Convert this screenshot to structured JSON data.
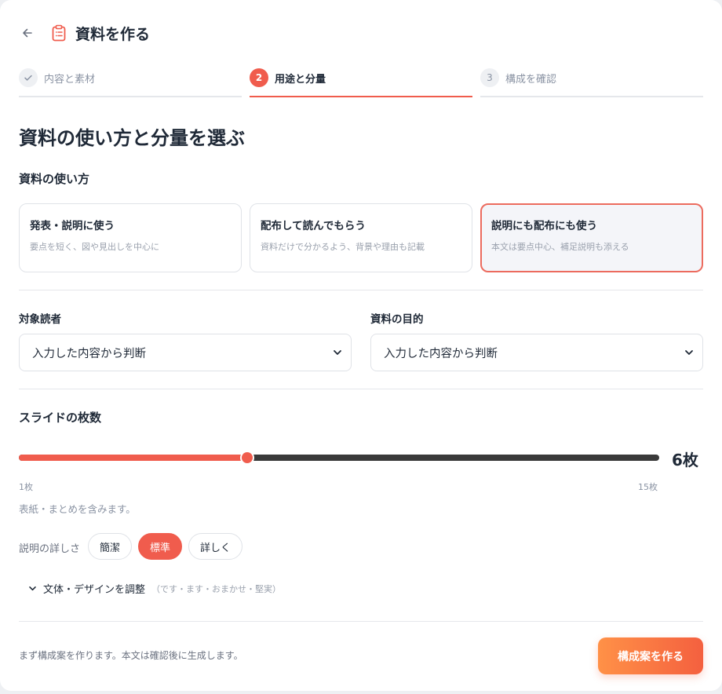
{
  "header": {
    "title": "資料を作る"
  },
  "steps": [
    {
      "number": "✓",
      "label": "内容と素材",
      "state": "done"
    },
    {
      "number": "2",
      "label": "用途と分量",
      "state": "current"
    },
    {
      "number": "3",
      "label": "構成を確認",
      "state": "todo"
    }
  ],
  "page_heading": "資料の使い方と分量を選ぶ",
  "usage": {
    "label": "資料の使い方",
    "options": [
      {
        "title": "発表・説明に使う",
        "desc": "要点を短く、図や見出しを中心に"
      },
      {
        "title": "配布して読んでもらう",
        "desc": "資料だけで分かるよう、背景や理由も記載"
      },
      {
        "title": "説明にも配布にも使う",
        "desc": "本文は要点中心、補足説明も添える"
      }
    ],
    "selected_index": 2
  },
  "audience": {
    "label": "対象読者",
    "value": "入力した内容から判断"
  },
  "purpose": {
    "label": "資料の目的",
    "value": "入力した内容から判断"
  },
  "slides": {
    "label": "スライドの枚数",
    "min": 1,
    "max": 15,
    "value": 6,
    "value_text": "6枚",
    "min_label": "1枚",
    "max_label": "15枚",
    "hint": "表紙・まとめを含みます。"
  },
  "detail": {
    "label": "説明の詳しさ",
    "options": [
      "簡潔",
      "標準",
      "詳しく"
    ],
    "selected_index": 1
  },
  "style_expander": {
    "label": "文体・デザインを調整",
    "sub": "（です・ます・おまかせ・堅実）"
  },
  "footer": {
    "note": "まず構成案を作ります。本文は確認後に生成します。",
    "cta_label": "構成案を作る"
  },
  "colors": {
    "accent": "#f05c4d",
    "cta_start": "#ff9147",
    "cta_end": "#f4603f",
    "track": "#3a3a3a"
  }
}
